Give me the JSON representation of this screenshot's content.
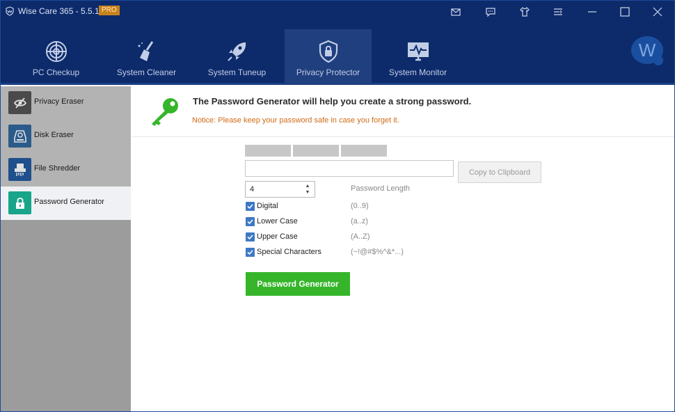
{
  "window": {
    "title": "Wise Care 365 - 5.5.1",
    "badge": "PRO"
  },
  "titlebar_icons": [
    "mail-icon",
    "feedback-icon",
    "skin-icon",
    "menu-icon",
    "minimize-icon",
    "maximize-icon",
    "close-icon"
  ],
  "nav": {
    "items": [
      {
        "label": "PC Checkup",
        "icon": "radar-icon"
      },
      {
        "label": "System Cleaner",
        "icon": "broom-icon"
      },
      {
        "label": "System Tuneup",
        "icon": "rocket-icon"
      },
      {
        "label": "Privacy Protector",
        "icon": "shield-lock-icon",
        "active": true
      },
      {
        "label": "System Monitor",
        "icon": "monitor-pulse-icon"
      }
    ],
    "avatar_letter": "W"
  },
  "sidebar": {
    "items": [
      {
        "label": "Privacy Eraser",
        "icon": "eye-slash-icon"
      },
      {
        "label": "Disk Eraser",
        "icon": "disk-icon"
      },
      {
        "label": "File Shredder",
        "icon": "shredder-icon"
      },
      {
        "label": "Password Generator",
        "icon": "lock-icon",
        "active": true
      }
    ]
  },
  "content": {
    "headline": "The Password Generator will help you create a strong password.",
    "notice": "Notice: Please keep your password safe in case you forget it.",
    "password_value": "",
    "copy_button": "Copy to Clipboard",
    "length_value": "4",
    "length_label": "Password Length",
    "options": [
      {
        "label": "Digital",
        "range": "(0..9)",
        "checked": true
      },
      {
        "label": "Lower Case",
        "range": "(a..z)",
        "checked": true
      },
      {
        "label": "Upper Case",
        "range": "(A..Z)",
        "checked": true
      },
      {
        "label": "Special Characters",
        "range": "(~!@#$%^&*...)",
        "checked": true
      }
    ],
    "generate_button": "Password Generator"
  },
  "colors": {
    "titlebar_bg": "#0d2b6b",
    "accent_green": "#36b52b",
    "notice_orange": "#d06a16",
    "checkbox_blue": "#3d78c6"
  }
}
